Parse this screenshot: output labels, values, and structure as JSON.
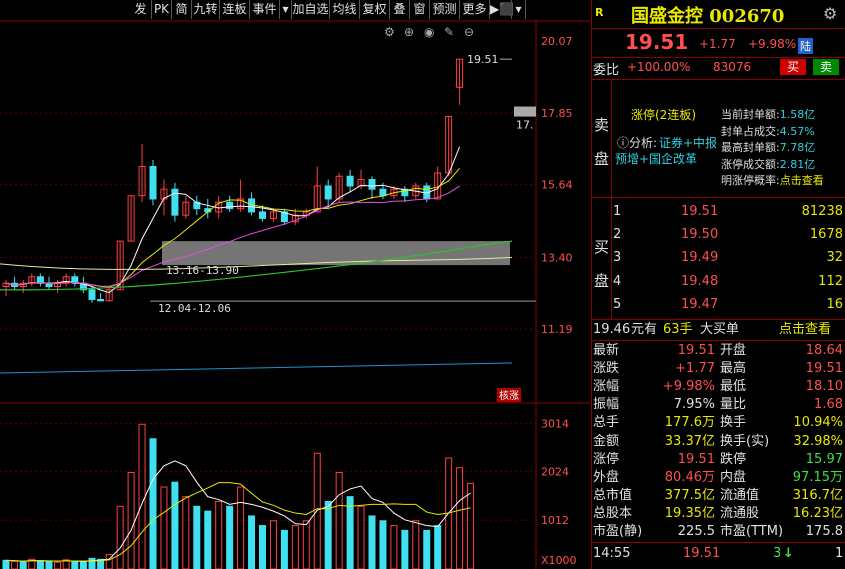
{
  "toolbar": {
    "items": [
      "发",
      "PK",
      "简",
      "九转",
      "连板",
      "事件",
      "▾",
      "加自选",
      "均线",
      "复权",
      "叠",
      "窗",
      "预测",
      "更多",
      "▶⬛",
      "▾"
    ]
  },
  "chart": {
    "price_ticks": [
      "20.07",
      "17.85",
      "15.64",
      "13.40",
      "11.19"
    ],
    "vol_ticks": [
      "3014",
      "2024",
      "1012",
      "X1000"
    ],
    "peak_label": "19.51",
    "limit_label": "17.",
    "zone1_label": "13.16-13.90",
    "zone2_label": "12.04-12.06",
    "badge": "核涨",
    "candles": [
      {
        "o": 12.5,
        "h": 12.7,
        "l": 12.2,
        "c": 12.6
      },
      {
        "o": 12.6,
        "h": 12.8,
        "l": 12.4,
        "c": 12.5
      },
      {
        "o": 12.5,
        "h": 12.7,
        "l": 12.3,
        "c": 12.6
      },
      {
        "o": 12.6,
        "h": 12.9,
        "l": 12.5,
        "c": 12.8
      },
      {
        "o": 12.8,
        "h": 12.9,
        "l": 12.5,
        "c": 12.6
      },
      {
        "o": 12.6,
        "h": 12.8,
        "l": 12.4,
        "c": 12.5
      },
      {
        "o": 12.5,
        "h": 12.7,
        "l": 12.3,
        "c": 12.6
      },
      {
        "o": 12.6,
        "h": 12.9,
        "l": 12.5,
        "c": 12.8
      },
      {
        "o": 12.8,
        "h": 12.9,
        "l": 12.5,
        "c": 12.6
      },
      {
        "o": 12.6,
        "h": 12.8,
        "l": 12.3,
        "c": 12.4
      },
      {
        "o": 12.4,
        "h": 12.5,
        "l": 12.0,
        "c": 12.1
      },
      {
        "o": 12.1,
        "h": 12.3,
        "l": 12.04,
        "c": 12.06
      },
      {
        "o": 12.06,
        "h": 12.5,
        "l": 12.04,
        "c": 12.4
      },
      {
        "o": 12.4,
        "h": 13.9,
        "l": 12.4,
        "c": 13.9
      },
      {
        "o": 13.9,
        "h": 15.3,
        "l": 13.9,
        "c": 15.3
      },
      {
        "o": 15.3,
        "h": 16.9,
        "l": 15.1,
        "c": 16.2
      },
      {
        "o": 16.2,
        "h": 16.4,
        "l": 15.0,
        "c": 15.2
      },
      {
        "o": 15.2,
        "h": 15.8,
        "l": 14.7,
        "c": 15.5
      },
      {
        "o": 15.5,
        "h": 15.7,
        "l": 14.5,
        "c": 14.7
      },
      {
        "o": 14.7,
        "h": 15.3,
        "l": 14.6,
        "c": 15.1
      },
      {
        "o": 15.1,
        "h": 15.3,
        "l": 14.7,
        "c": 14.9
      },
      {
        "o": 14.9,
        "h": 15.2,
        "l": 14.6,
        "c": 14.8
      },
      {
        "o": 14.8,
        "h": 15.3,
        "l": 14.6,
        "c": 15.1
      },
      {
        "o": 15.1,
        "h": 15.3,
        "l": 14.8,
        "c": 14.9
      },
      {
        "o": 14.9,
        "h": 15.8,
        "l": 14.8,
        "c": 15.2
      },
      {
        "o": 15.2,
        "h": 15.4,
        "l": 14.7,
        "c": 14.8
      },
      {
        "o": 14.8,
        "h": 15.0,
        "l": 14.5,
        "c": 14.6
      },
      {
        "o": 14.6,
        "h": 14.9,
        "l": 14.5,
        "c": 14.8
      },
      {
        "o": 14.8,
        "h": 14.9,
        "l": 14.4,
        "c": 14.5
      },
      {
        "o": 14.5,
        "h": 14.9,
        "l": 14.4,
        "c": 14.7
      },
      {
        "o": 14.7,
        "h": 14.9,
        "l": 14.6,
        "c": 14.8
      },
      {
        "o": 14.8,
        "h": 16.2,
        "l": 14.8,
        "c": 15.6
      },
      {
        "o": 15.6,
        "h": 15.8,
        "l": 15.0,
        "c": 15.2
      },
      {
        "o": 15.2,
        "h": 16.0,
        "l": 15.1,
        "c": 15.9
      },
      {
        "o": 15.9,
        "h": 16.1,
        "l": 15.4,
        "c": 15.6
      },
      {
        "o": 15.6,
        "h": 16.1,
        "l": 15.5,
        "c": 15.8
      },
      {
        "o": 15.8,
        "h": 15.9,
        "l": 15.2,
        "c": 15.5
      },
      {
        "o": 15.5,
        "h": 15.7,
        "l": 15.2,
        "c": 15.3
      },
      {
        "o": 15.3,
        "h": 15.6,
        "l": 15.2,
        "c": 15.5
      },
      {
        "o": 15.5,
        "h": 15.6,
        "l": 15.1,
        "c": 15.3
      },
      {
        "o": 15.3,
        "h": 15.7,
        "l": 15.2,
        "c": 15.6
      },
      {
        "o": 15.6,
        "h": 15.7,
        "l": 15.1,
        "c": 15.2
      },
      {
        "o": 15.2,
        "h": 16.2,
        "l": 15.2,
        "c": 16.0
      },
      {
        "o": 16.0,
        "h": 17.74,
        "l": 15.9,
        "c": 17.74
      },
      {
        "o": 18.64,
        "h": 19.51,
        "l": 18.1,
        "c": 19.51
      }
    ],
    "volumes": [
      180,
      160,
      150,
      200,
      170,
      150,
      140,
      190,
      160,
      150,
      220,
      200,
      300,
      1300,
      2000,
      3000,
      2700,
      1700,
      1800,
      1500,
      1300,
      1200,
      1400,
      1300,
      1700,
      1100,
      900,
      1000,
      800,
      900,
      1000,
      2400,
      1400,
      2000,
      1500,
      1300,
      1100,
      1000,
      900,
      800,
      1000,
      800,
      900,
      2300,
      2100,
      1776
    ],
    "vol_colors": [
      "c",
      "r",
      "c",
      "r",
      "c",
      "c",
      "r",
      "r",
      "c",
      "c",
      "c",
      "c",
      "r",
      "r",
      "r",
      "r",
      "c",
      "r",
      "c",
      "r",
      "c",
      "c",
      "r",
      "c",
      "r",
      "c",
      "c",
      "r",
      "c",
      "r",
      "r",
      "r",
      "c",
      "r",
      "c",
      "r",
      "c",
      "c",
      "r",
      "c",
      "r",
      "c",
      "c",
      "r",
      "r",
      "r"
    ]
  },
  "panel": {
    "logo": "R",
    "name_code": "国盛金控 002670",
    "price": "19.51",
    "change": "+1.77",
    "pct": "+9.98%",
    "market": "陆",
    "wb_label": "委比",
    "wb_value": "+100.00%",
    "wb_diff": "83076",
    "buy_btn": "买",
    "sell_btn": "卖",
    "sell_side": "卖盘",
    "limit_text": "涨停(2连板)",
    "analysis_label": "分析:",
    "analysis_tags": "证券+中报",
    "analysis_tags2": "预增+国企改革",
    "seal_rows": [
      {
        "k": "当前封单额:",
        "v": "1.58亿"
      },
      {
        "k": "封单占成交:",
        "v": "4.57%"
      },
      {
        "k": "最高封单额:",
        "v": "7.78亿"
      },
      {
        "k": "涨停成交额:",
        "v": "2.81亿"
      },
      {
        "k": "明涨停概率:",
        "v": "点击查看"
      }
    ],
    "buy_side": "买盘",
    "bids": [
      {
        "lvl": "1",
        "p": "19.51",
        "v": "81238"
      },
      {
        "lvl": "2",
        "p": "19.50",
        "v": "1678"
      },
      {
        "lvl": "3",
        "p": "19.49",
        "v": "32"
      },
      {
        "lvl": "4",
        "p": "19.48",
        "v": "112"
      },
      {
        "lvl": "5",
        "p": "19.47",
        "v": "16"
      }
    ],
    "big_buy": {
      "price": "19.46",
      "unit": "元有",
      "qty": "63手",
      "label": "大买单",
      "link": "点击查看"
    },
    "stats": [
      {
        "k1": "最新",
        "v1": "19.51",
        "c1": "r",
        "k2": "开盘",
        "v2": "18.64",
        "c2": "r"
      },
      {
        "k1": "涨跌",
        "v1": "+1.77",
        "c1": "r",
        "k2": "最高",
        "v2": "19.51",
        "c2": "r"
      },
      {
        "k1": "涨幅",
        "v1": "+9.98%",
        "c1": "r",
        "k2": "最低",
        "v2": "18.10",
        "c2": "r"
      },
      {
        "k1": "振幅",
        "v1": "7.95%",
        "c1": "w",
        "k2": "量比",
        "v2": "1.68",
        "c2": "r"
      },
      {
        "k1": "总手",
        "v1": "177.6万",
        "c1": "y",
        "k2": "换手",
        "v2": "10.94%",
        "c2": "y"
      },
      {
        "k1": "金额",
        "v1": "33.37亿",
        "c1": "y",
        "k2": "换手(实)",
        "v2": "32.98%",
        "c2": "y"
      },
      {
        "k1": "涨停",
        "v1": "19.51",
        "c1": "r",
        "k2": "跌停",
        "v2": "15.97",
        "c2": "g"
      },
      {
        "k1": "外盘",
        "v1": "80.46万",
        "c1": "r",
        "k2": "内盘",
        "v2": "97.15万",
        "c2": "g"
      },
      {
        "k1": "总市值",
        "v1": "377.5亿",
        "c1": "y",
        "k2": "流通值",
        "v2": "316.7亿",
        "c2": "y"
      },
      {
        "k1": "总股本",
        "v1": "19.35亿",
        "c1": "y",
        "k2": "流通股",
        "v2": "16.23亿",
        "c2": "y"
      },
      {
        "k1": "市盈(静)",
        "v1": "225.5",
        "c1": "w",
        "k2": "市盈(TTM)",
        "v2": "175.8",
        "c2": "w"
      }
    ],
    "tick": {
      "time": "14:55",
      "price": "19.51",
      "vol": "3",
      "arrow": "↓",
      "n": "1"
    }
  }
}
